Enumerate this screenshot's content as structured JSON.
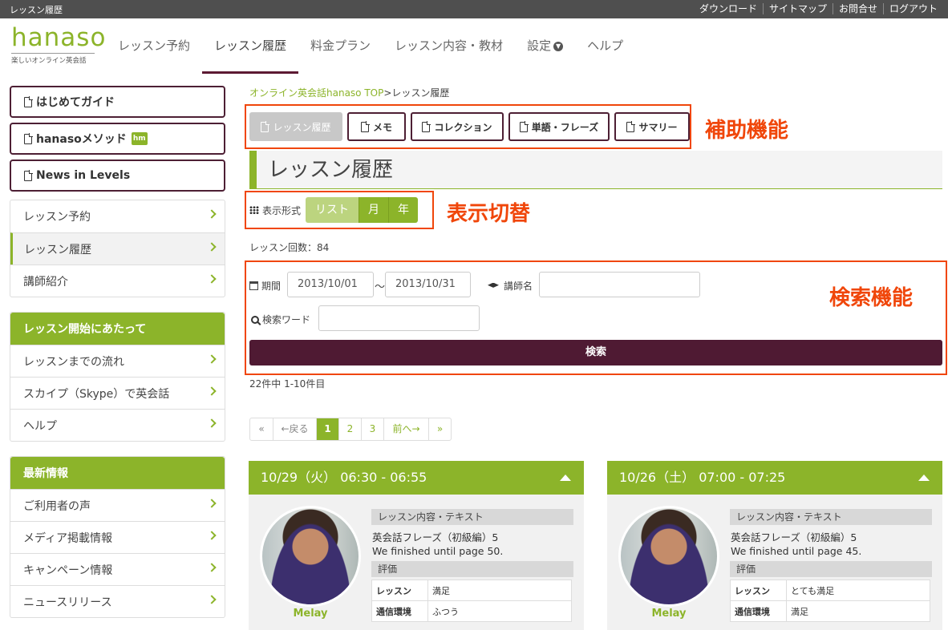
{
  "topbar": {
    "site_label": "レッスン履歴",
    "links": [
      "ダウンロード",
      "サイトマップ",
      "お問合せ",
      "ログアウト"
    ]
  },
  "logo": {
    "wordmark": "hanaso",
    "tagline": "楽しいオンライン英会話"
  },
  "global_nav": [
    "レッスン予約",
    "レッスン履歴",
    "料金プラン",
    "レッスン内容・教材",
    "設定",
    "ヘルプ"
  ],
  "sidebar": {
    "guides": [
      "はじめてガイド",
      "hanasoメソッド",
      "News in Levels"
    ],
    "guide_badge": "hm",
    "menu": [
      "レッスン予約",
      "レッスン履歴",
      "講師紹介"
    ],
    "start_section": {
      "title": "レッスン開始にあたって",
      "items": [
        "レッスンまでの流れ",
        "スカイプ（Skype）で英会話",
        "ヘルプ"
      ]
    },
    "news_section": {
      "title": "最新情報",
      "items": [
        "ご利用者の声",
        "メディア掲載情報",
        "キャンペーン情報",
        "ニュースリリース"
      ]
    }
  },
  "breadcrumb": {
    "home": "オンライン英会話hanaso TOP",
    "sep": ">",
    "current": "レッスン履歴"
  },
  "subnav": [
    "レッスン履歴",
    "メモ",
    "コレクション",
    "単語・フレーズ",
    "サマリー"
  ],
  "annotations": {
    "aux": "補助機能",
    "view": "表示切替",
    "search": "検索機能"
  },
  "page_title": "レッスン履歴",
  "view_mode": {
    "label": "表示形式",
    "options": [
      "リスト",
      "月",
      "年"
    ]
  },
  "lesson_count": "レッスン回数：84",
  "search": {
    "period_label": "期間",
    "from": "2013/10/01",
    "tilde": "～",
    "to": "2013/10/31",
    "teacher_label": "講師名",
    "teacher_value": "",
    "keyword_label": "検索ワード",
    "keyword_value": "",
    "button": "検索"
  },
  "result_count": "22件中 1-10件目",
  "pager": [
    "«",
    "←戻る",
    "1",
    "2",
    "3",
    "前へ→",
    "»"
  ],
  "cards": [
    {
      "date": "10/29（火） 06:30 - 06:55",
      "teacher": "Melay",
      "content_label": "レッスン内容・テキスト",
      "text1": "英会話フレーズ（初級編）5",
      "text2": "We finished until page 50.",
      "eval_label": "評価",
      "rows": [
        [
          "レッスン",
          "満足"
        ],
        [
          "通信環境",
          "ふつう"
        ]
      ]
    },
    {
      "date": "10/26（土） 07:00 - 07:25",
      "teacher": "Melay",
      "content_label": "レッスン内容・テキスト",
      "text1": "英会話フレーズ（初級編）5",
      "text2": "We finished until page 45.",
      "eval_label": "評価",
      "rows": [
        [
          "レッスン",
          "とても満足"
        ],
        [
          "通信環境",
          "満足"
        ]
      ]
    }
  ],
  "colors": {
    "accent": "#8cb42a",
    "brand_dark": "#4f1a33",
    "annotation": "#f0460a"
  }
}
